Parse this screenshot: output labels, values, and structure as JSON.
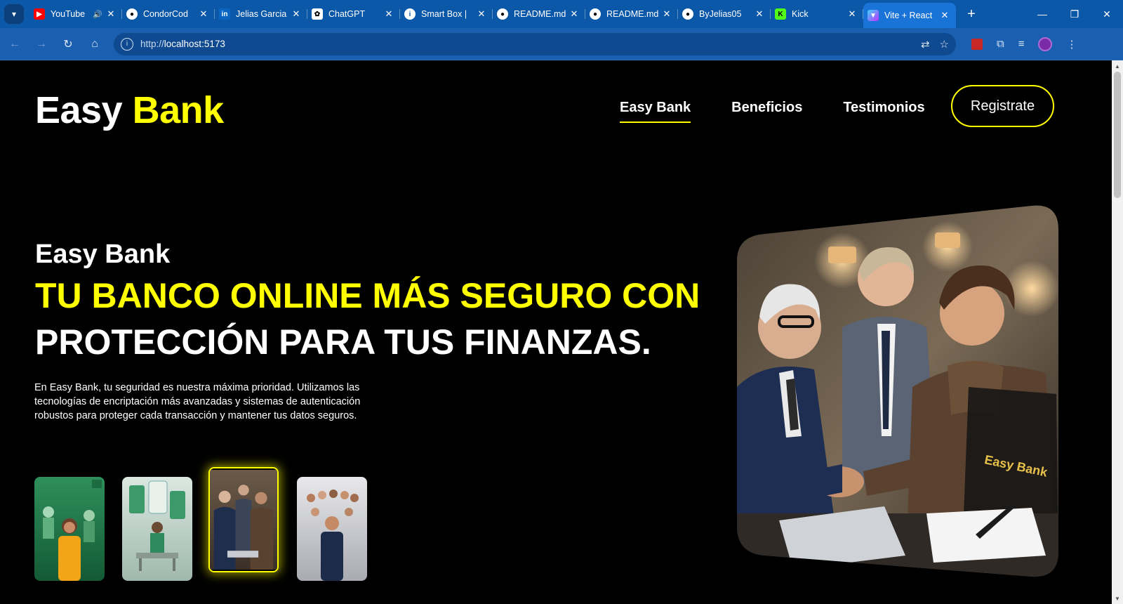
{
  "browser": {
    "tabs": [
      {
        "title": "YouTube",
        "favicon": "youtube-icon",
        "color": "#ff0000",
        "muted": true
      },
      {
        "title": "CondorCod",
        "favicon": "github-icon",
        "color": "#ffffff"
      },
      {
        "title": "Jelias Garcia",
        "favicon": "linkedin-icon",
        "color": "#0a66c2"
      },
      {
        "title": "ChatGPT",
        "favicon": "chatgpt-icon",
        "color": "#ffffff"
      },
      {
        "title": "Smart Box |",
        "favicon": "info-icon",
        "color": "#ffffff"
      },
      {
        "title": "README.md",
        "favicon": "github-icon",
        "color": "#ffffff"
      },
      {
        "title": "README.md",
        "favicon": "github-icon",
        "color": "#ffffff"
      },
      {
        "title": "ByJelias05",
        "favicon": "github-icon",
        "color": "#ffffff"
      },
      {
        "title": "Kick",
        "favicon": "kick-icon",
        "color": "#53fc18"
      },
      {
        "title": "Vite + React",
        "favicon": "vite-icon",
        "color": "#bd34fe",
        "active": true
      }
    ],
    "url_scheme": "http://",
    "url_host": "localhost:5173"
  },
  "site": {
    "logo_main": "Easy",
    "logo_accent": "Bank",
    "nav": [
      "Easy Bank",
      "Beneficios",
      "Testimonios"
    ],
    "register_label": "Registrate",
    "hero_subtitle": "Easy Bank",
    "hero_line1": "TU BANCO ONLINE MÁS SEGURO CON",
    "hero_line2": "PROTECCIÓN PARA TUS FINANZAS.",
    "hero_paragraph": "En Easy Bank, tu seguridad es nuestra máxima prioridad. Utilizamos las tecnologías de encriptación más avanzadas y sistemas de autenticación robustos para proteger cada transacción y mantener tus datos seguros.",
    "selected_thumbnail": 3,
    "image_badge": "Easy Bank",
    "accent_color": "#ffff00"
  }
}
